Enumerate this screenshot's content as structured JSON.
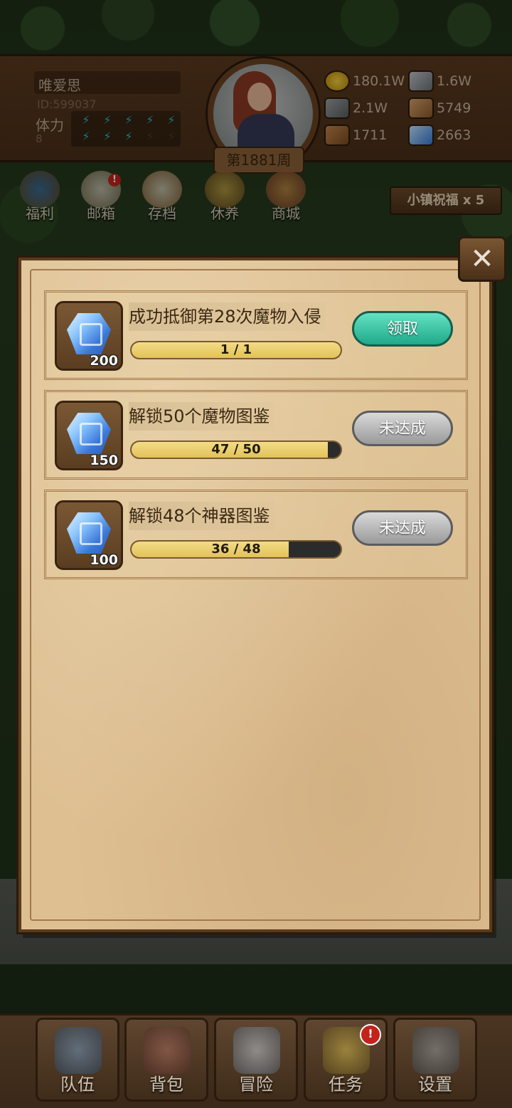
{
  "header": {
    "player_name": "唯爱思",
    "player_id": "ID:599037",
    "stamina_label": "体力",
    "stamina_value": "8",
    "week": "第1881周",
    "resources": [
      {
        "icon": "gold-coin-icon",
        "value": "180.1W"
      },
      {
        "icon": "iron-ingot-icon",
        "value": "1.6W"
      },
      {
        "icon": "stone-icon",
        "value": "2.1W"
      },
      {
        "icon": "cloth-icon",
        "value": "5749"
      },
      {
        "icon": "wood-log-icon",
        "value": "1711"
      },
      {
        "icon": "crystal-icon",
        "value": "2663"
      }
    ]
  },
  "menu": {
    "items": [
      {
        "label": "福利",
        "icon": "welfare-icon"
      },
      {
        "label": "邮箱",
        "icon": "mail-icon",
        "badge": "!"
      },
      {
        "label": "存档",
        "icon": "save-icon"
      },
      {
        "label": "休养",
        "icon": "rest-icon"
      },
      {
        "label": "商城",
        "icon": "shop-icon"
      }
    ],
    "blessing": "小镇祝福 x 5"
  },
  "dialog": {
    "close_icon": "close-x-icon",
    "tasks": [
      {
        "title": "成功抵御第28次魔物入侵",
        "reward": "200",
        "progress_text": "1 / 1",
        "progress": 1.0,
        "button": "领取",
        "state": "claim"
      },
      {
        "title": "解锁50个魔物图鉴",
        "reward": "150",
        "progress_text": "47 / 50",
        "progress": 0.94,
        "button": "未达成",
        "state": "pending"
      },
      {
        "title": "解锁48个神器图鉴",
        "reward": "100",
        "progress_text": "36 / 48",
        "progress": 0.75,
        "button": "未达成",
        "state": "pending"
      }
    ]
  },
  "bottom_nav": {
    "items": [
      {
        "label": "队伍",
        "icon": "helmet-icon"
      },
      {
        "label": "背包",
        "icon": "backpack-icon"
      },
      {
        "label": "冒险",
        "icon": "crossed-swords-icon"
      },
      {
        "label": "任务",
        "icon": "quest-icon",
        "badge": "!"
      },
      {
        "label": "设置",
        "icon": "gear-icon"
      }
    ]
  },
  "colors": {
    "parchment": "#ddbf92",
    "claim_button": "#1ea98a",
    "pending_button": "#9a9a9a",
    "progress_fill": "#e2c25a",
    "badge_red": "#c2231b"
  }
}
